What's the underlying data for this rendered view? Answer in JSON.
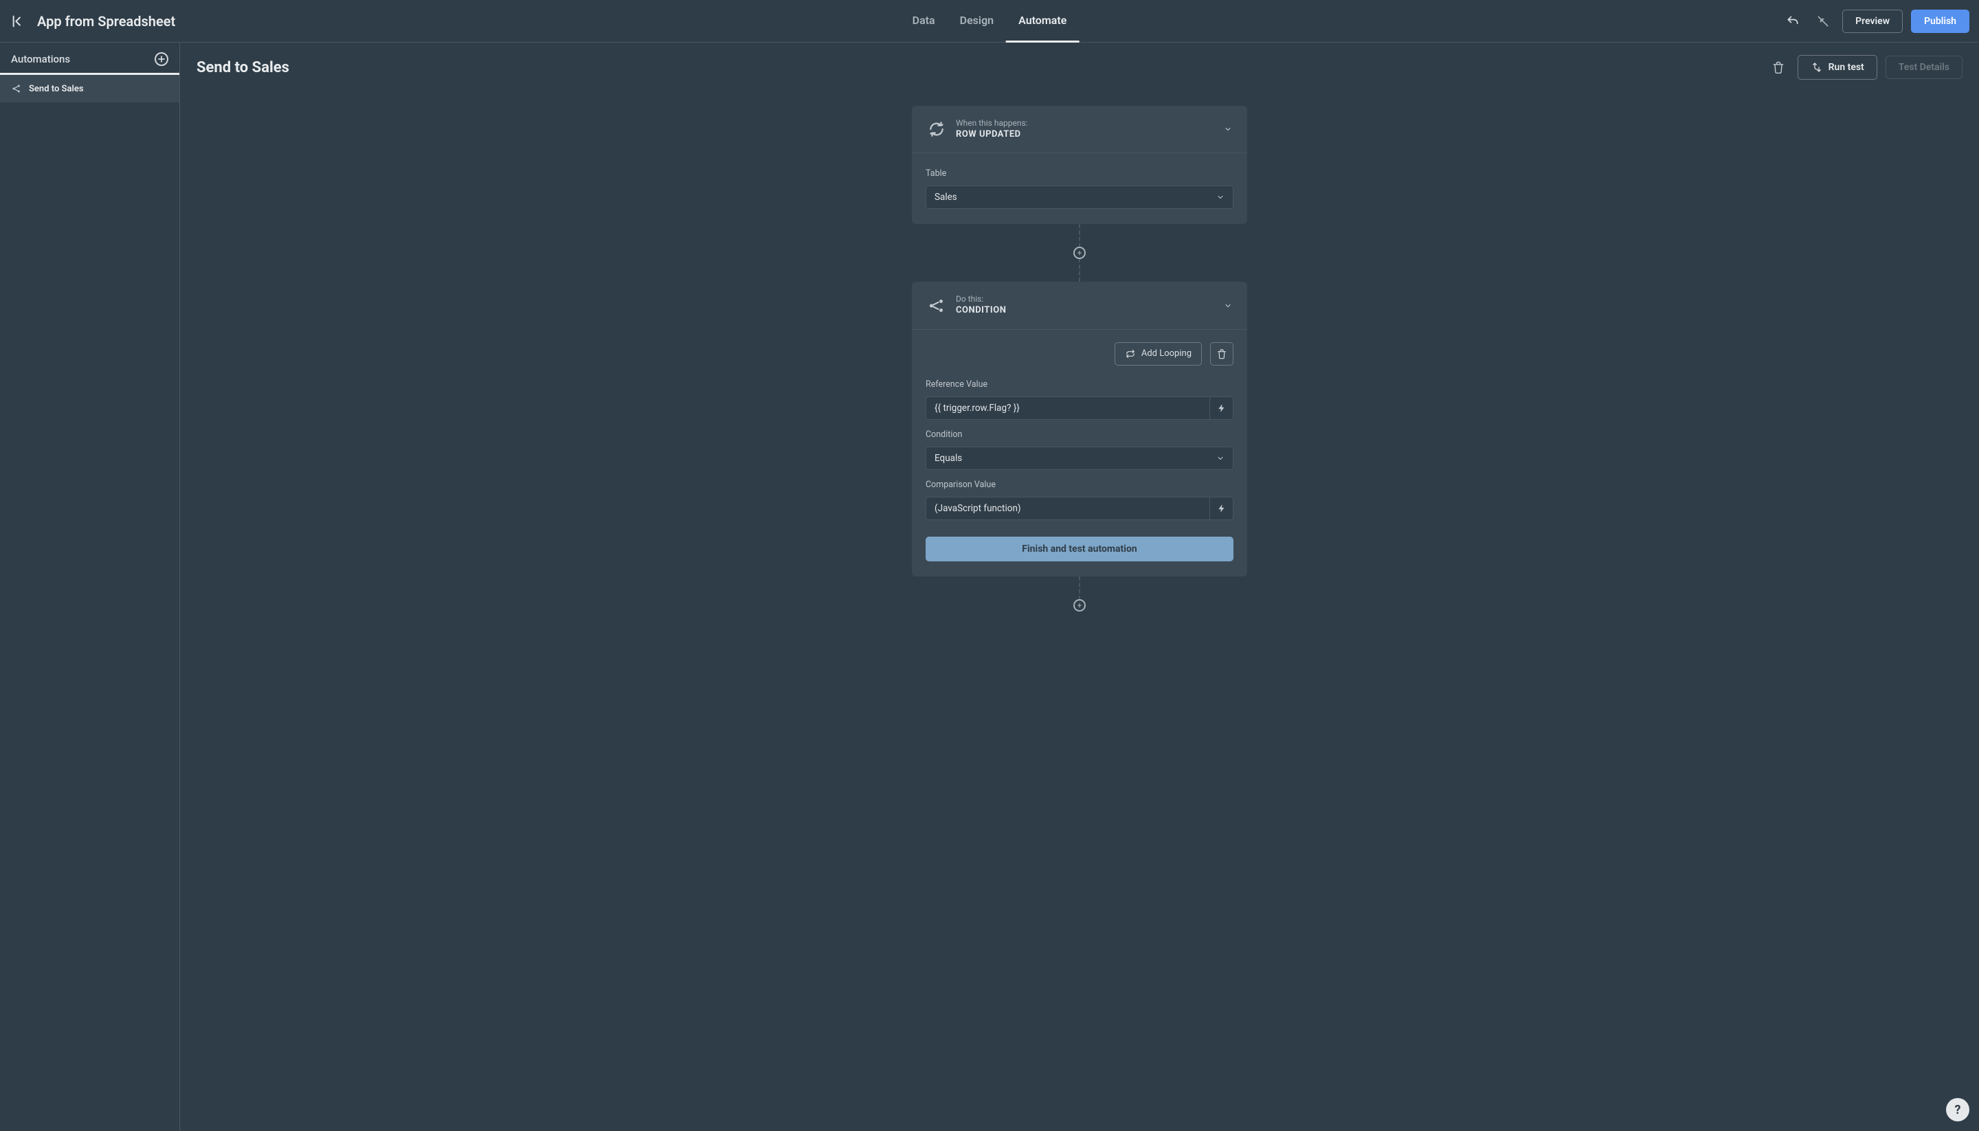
{
  "header": {
    "app_title": "App from Spreadsheet",
    "tabs": {
      "data": "Data",
      "design": "Design",
      "automate": "Automate"
    },
    "preview_label": "Preview",
    "publish_label": "Publish"
  },
  "sidebar": {
    "title": "Automations",
    "items": [
      {
        "label": "Send to Sales"
      }
    ]
  },
  "canvas": {
    "title": "Send to Sales",
    "run_test_label": "Run test",
    "test_details_label": "Test Details"
  },
  "trigger_card": {
    "supertitle": "When this happens:",
    "title": "ROW UPDATED",
    "table_label": "Table",
    "table_value": "Sales"
  },
  "action_card": {
    "supertitle": "Do this:",
    "title": "CONDITION",
    "add_looping_label": "Add Looping",
    "reference_label": "Reference Value",
    "reference_value": "{{ trigger.row.Flag? }}",
    "condition_label": "Condition",
    "condition_value": "Equals",
    "comparison_label": "Comparison Value",
    "comparison_value": "(JavaScript function)",
    "finish_label": "Finish and test automation"
  },
  "help": {
    "label": "?"
  }
}
